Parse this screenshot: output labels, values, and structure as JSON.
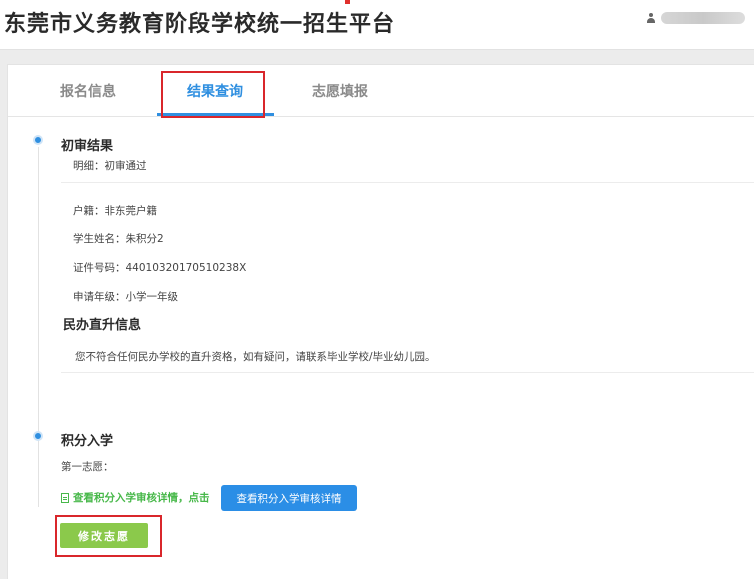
{
  "header": {
    "site_title": "东莞市义务教育阶段学校统一招生平台",
    "user_icon": "user-icon"
  },
  "tabs": [
    {
      "label": "报名信息",
      "active": false
    },
    {
      "label": "结果查询",
      "active": true
    },
    {
      "label": "志愿填报",
      "active": false
    }
  ],
  "initial_review": {
    "title": "初审结果",
    "detail": "明细：初审通过",
    "household": "户籍：非东莞户籍",
    "student_name": "学生姓名：朱积分2",
    "id_number": "证件号码：44010320170510238X",
    "grade": "申请年级：小学一年级"
  },
  "private_promotion": {
    "title": "民办直升信息",
    "message": "您不符合任何民办学校的直升资格，如有疑问，请联系毕业学校/毕业幼儿园。"
  },
  "points_admission": {
    "title": "积分入学",
    "first_choice": "第一志愿：",
    "link_text": "查看积分入学审核详情，点击",
    "detail_button": "查看积分入学审核详情",
    "modify_button": "修改志愿"
  },
  "colors": {
    "accent": "#2f8fe0",
    "green": "#48b84a",
    "button_green": "#8bc94b",
    "highlight_red": "#d9262b"
  }
}
